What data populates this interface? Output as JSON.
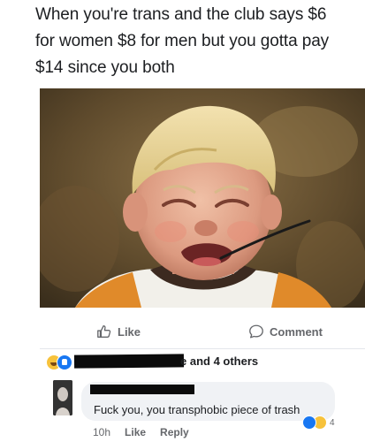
{
  "post": {
    "caption_lines": [
      "When you're trans and the club says $6",
      "for women $8 for men but you gotta pay",
      "$14 since you both"
    ]
  },
  "actions": {
    "like_label": "Like",
    "comment_label": "Comment"
  },
  "reactions": {
    "summary": "e and 4 others",
    "emoji": [
      "haha-icon",
      "like-icon"
    ]
  },
  "comment": {
    "text": "Fuck you, you transphobic piece of trash",
    "time": "10h",
    "like_label": "Like",
    "reply_label": "Reply",
    "reaction_count": "4"
  },
  "colors": {
    "facebook_blue": "#1877f2",
    "haha_yellow": "#f7c23b",
    "muted_text": "#65676b",
    "bubble_bg": "#f0f2f5"
  }
}
